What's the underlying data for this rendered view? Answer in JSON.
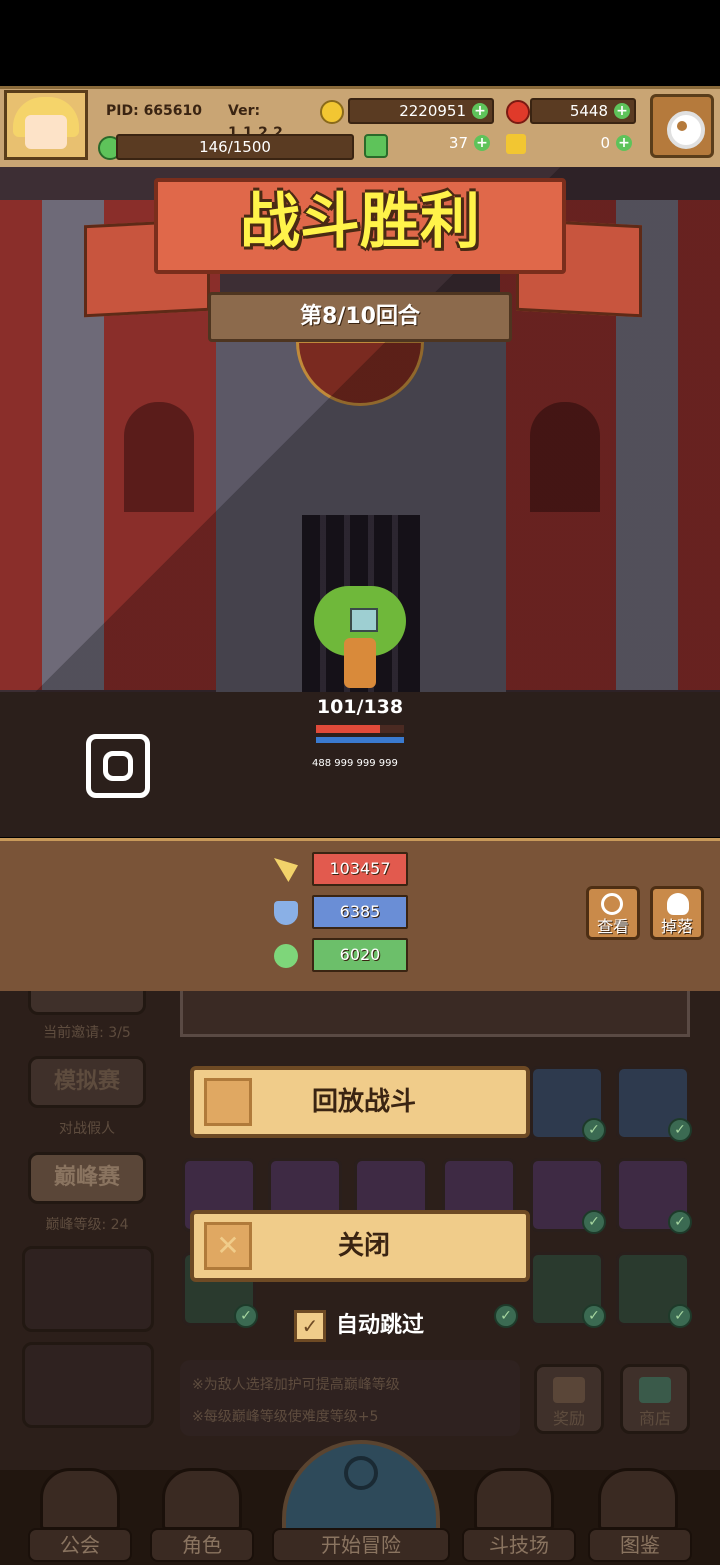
{
  "header": {
    "pid": "PID: 665610",
    "version": "Ver: 1.1.2.2",
    "gold": "2220951",
    "gems": "5448",
    "stamina": "146/1500",
    "clover": "37",
    "keys": "0"
  },
  "battle": {
    "title": "战斗胜利",
    "round": "第8/10回合",
    "enemy_hp": "101/138",
    "enemy_stats": "488 999 999 999",
    "hp_fraction": 0.73
  },
  "stats_panel": {
    "attack": "103457",
    "defense": "6385",
    "heal": "6020",
    "view_label": "查看",
    "drop_label": "掉落"
  },
  "left_menu": {
    "invite_text": "当前邀请: 3/5",
    "sim_button": "模拟赛",
    "sim_sub": "对战假人",
    "peak_button": "巅峰赛",
    "peak_sub": "巅峰等级: 24"
  },
  "dialog": {
    "replay_label": "回放战斗",
    "close_label": "关闭",
    "auto_skip_label": "自动跳过",
    "auto_skip_checked": true
  },
  "tips": {
    "tip1": "※为敌人选择加护可提高巅峰等级",
    "tip2": "※每级巅峰等级使难度等级+5"
  },
  "shop": {
    "reward_label": "奖励",
    "shop_label": "商店"
  },
  "nav": {
    "guild": "公会",
    "character": "角色",
    "adventure": "开始冒险",
    "arena": "斗技场",
    "codex": "图鉴"
  },
  "colors": {
    "attack": "#e25a4e",
    "defense": "#6a8ed6",
    "heal": "#6cbf6a",
    "title_text": "#fff34a",
    "banner": "#e0684a"
  }
}
